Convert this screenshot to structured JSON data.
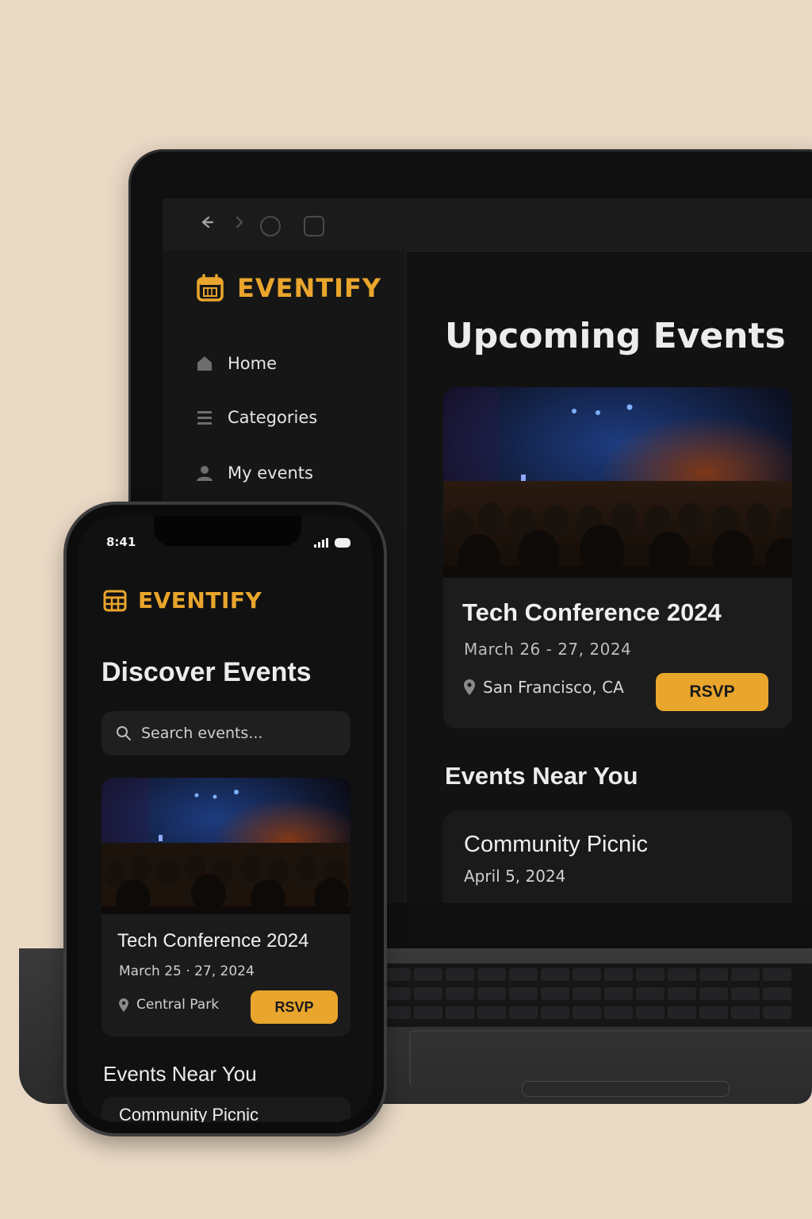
{
  "laptop": {
    "browser": {
      "icons": [
        "back-arrow-icon",
        "forward-arrow-icon",
        "circle-icon",
        "square-icon"
      ]
    },
    "brand": "EVENTIFY",
    "sidebar": {
      "items": [
        {
          "label": "Home",
          "icon": "home-icon"
        },
        {
          "label": "Categories",
          "icon": "list-icon"
        },
        {
          "label": "My events",
          "icon": "user-icon"
        }
      ]
    },
    "main": {
      "title": "Upcoming Events",
      "featured": {
        "title": "Tech Conference 2024",
        "date": "March 26 - 27, 2024",
        "location": "San Francisco, CA",
        "rsvp": "RSVP"
      },
      "near_title": "Events Near You",
      "near": {
        "name": "Community Picnic",
        "date": "April 5, 2024"
      }
    }
  },
  "phone": {
    "time": "8:41",
    "brand": "EVENTIFY",
    "title": "Discover Events",
    "search_placeholder": "Search events...",
    "featured": {
      "title": "Tech Conference 2024",
      "date": "March 25 · 27, 2024",
      "location": "Central Park",
      "rsvp": "RSVP"
    },
    "near_title": "Events Near You",
    "near": {
      "name": "Community Picnic"
    }
  },
  "colors": {
    "accent": "#e9a52c",
    "background": "#ead9c5",
    "panel": "#121212",
    "card": "#1c1c1d"
  }
}
